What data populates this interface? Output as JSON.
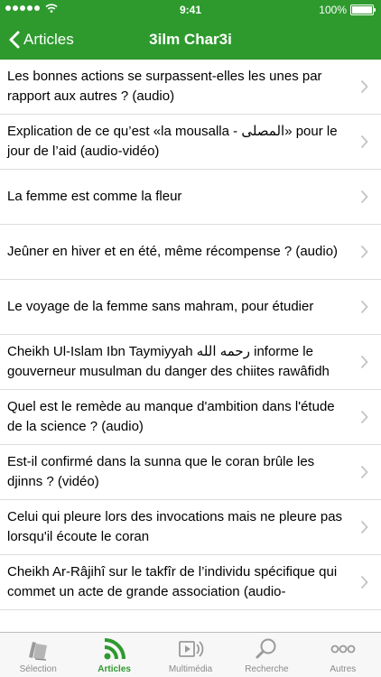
{
  "status_bar": {
    "time": "9:41",
    "battery": "100%"
  },
  "nav": {
    "back_label": "Articles",
    "title": "3ilm Char3i"
  },
  "articles": [
    "Les bonnes actions se surpassent-elles les unes par rapport aux autres ? (audio)",
    "Explication de ce qu’est «la mousalla - المصلى» pour le jour de l’aid (audio-vidéo)",
    "La femme est comme la fleur",
    "Jeûner en hiver et en été, même récompense ? (audio)",
    "Le voyage de la femme sans mahram, pour étudier",
    "Cheikh Ul-Islam Ibn Taymiyyah رحمه الله informe le gouverneur musulman du danger des chiites rawâfidh",
    "Quel est le remède au manque d'ambition dans l'étude de la science ? (audio)",
    "Est-il confirmé dans la sunna que le coran brûle les djinns ? (vidéo)",
    "Celui qui pleure lors des invocations mais ne pleure pas lorsqu'il écoute le coran",
    "Cheikh Ar-Râjihî sur le takfîr de l’individu spécifique qui commet un acte de grande association (audio-"
  ],
  "tabs": [
    {
      "label": "Sélection",
      "icon": "books-icon",
      "active": false
    },
    {
      "label": "Articles",
      "icon": "rss-icon",
      "active": true
    },
    {
      "label": "Multimédia",
      "icon": "film-audio-icon",
      "active": false
    },
    {
      "label": "Recherche",
      "icon": "magnifier-icon",
      "active": false
    },
    {
      "label": "Autres",
      "icon": "more-icon",
      "active": false
    }
  ],
  "colors": {
    "accent": "#2e9a2e",
    "tab_inactive": "#8a8a8a"
  }
}
